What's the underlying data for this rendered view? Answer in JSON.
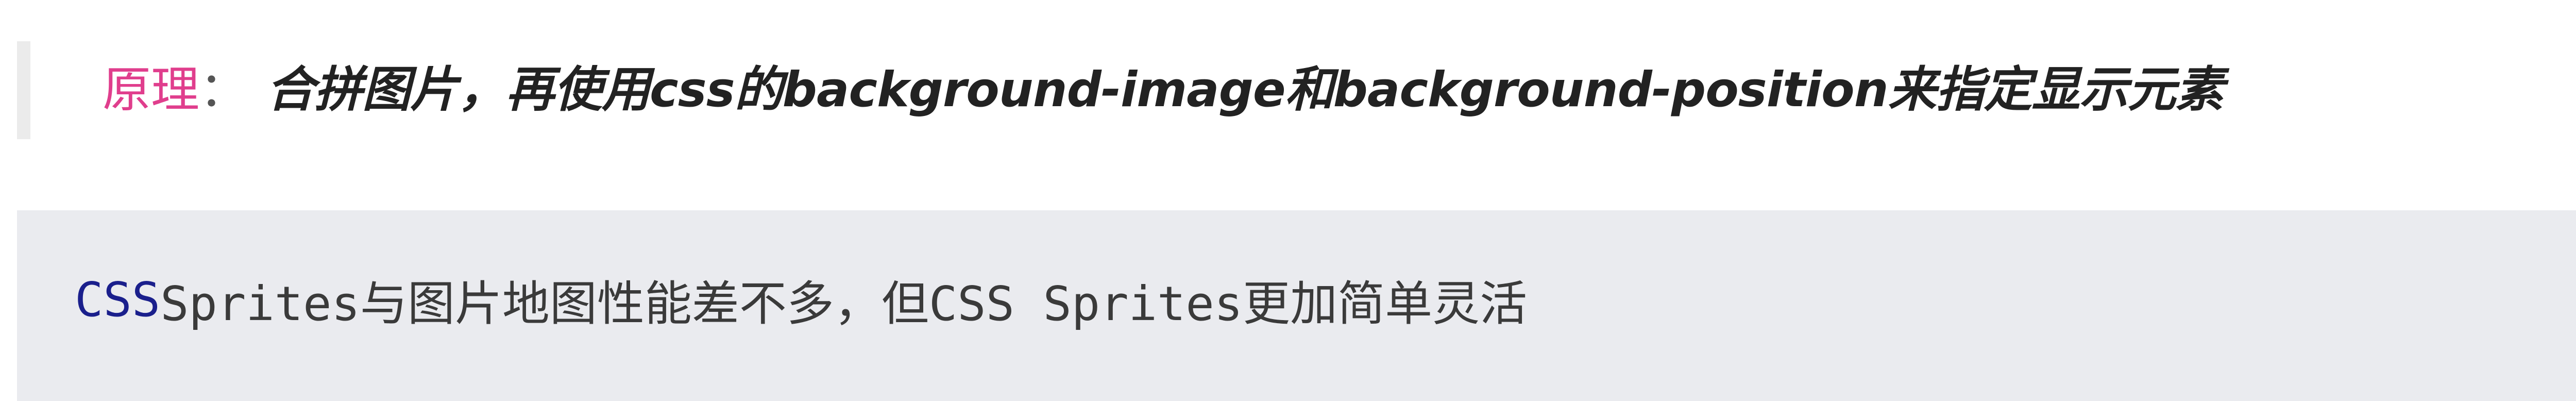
{
  "quote": {
    "label": "原理",
    "colon": "：",
    "text": "合拼图片，再使用css的background-image和background-position来指定显示元素"
  },
  "code": {
    "keyword": "CSS",
    "rest": " Sprites与图片地图性能差不多，但CSS Sprites更加简单灵活"
  },
  "colors": {
    "label_accent": "#e03e8d",
    "keyword_accent": "#1a1f8c",
    "code_background": "#eaebef",
    "quote_border": "#ebebeb"
  }
}
